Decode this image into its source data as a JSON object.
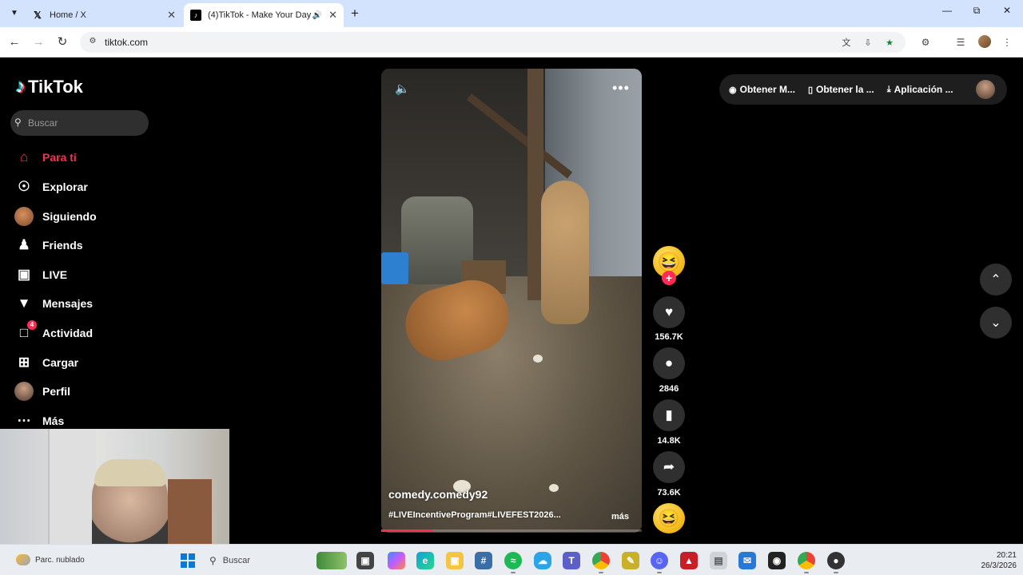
{
  "browser": {
    "tabs": [
      {
        "title": "Home / X",
        "favicon": "x-logo-icon",
        "active": false
      },
      {
        "title": "(4)TikTok - Make Your Day",
        "favicon": "tiktok-logo-icon",
        "active": true
      }
    ],
    "url": "tiktok.com"
  },
  "tiktok": {
    "logo_text": "TikTok",
    "search_placeholder": "Buscar",
    "sidebar": [
      {
        "label": "Para ti",
        "icon": "home-icon",
        "active": true
      },
      {
        "label": "Explorar",
        "icon": "compass-icon"
      },
      {
        "label": "Siguiendo",
        "icon": "following-avatar"
      },
      {
        "label": "Friends",
        "icon": "friends-icon"
      },
      {
        "label": "LIVE",
        "icon": "live-tv-icon"
      },
      {
        "label": "Mensajes",
        "icon": "messages-icon"
      },
      {
        "label": "Actividad",
        "icon": "activity-icon",
        "badge": "4"
      },
      {
        "label": "Cargar",
        "icon": "upload-icon"
      },
      {
        "label": "Perfil",
        "icon": "profile-avatar"
      },
      {
        "label": "Más",
        "icon": "more-icon"
      }
    ],
    "top_actions": [
      {
        "label": "Obtener M...",
        "icon": "coin-icon"
      },
      {
        "label": "Obtener la ...",
        "icon": "phone-icon"
      },
      {
        "label": "Aplicación ...",
        "icon": "download-icon"
      }
    ],
    "video": {
      "author": "comedy.comedy92",
      "description": "#LIVEIncentiveProgram#LIVEFEST2026...",
      "more_label": "más",
      "progress": 0.2
    },
    "actions": {
      "likes": "156.7K",
      "comments": "2846",
      "saves": "14.8K",
      "shares": "73.6K"
    },
    "accent": "#fe2c55"
  },
  "taskbar": {
    "weather": "Parc. nublado",
    "search_label": "Buscar",
    "time": "20:21",
    "date": "26/3/2026"
  }
}
